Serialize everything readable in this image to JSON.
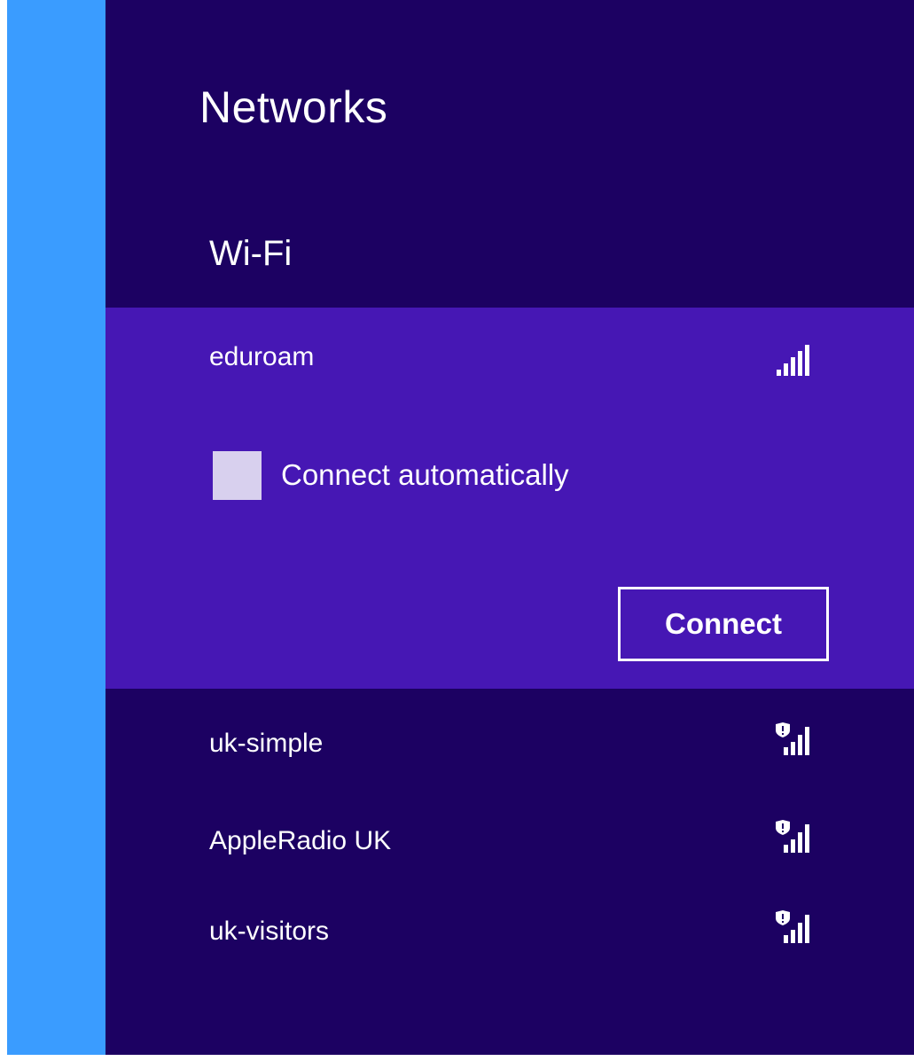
{
  "panel": {
    "title": "Networks",
    "section_label": "Wi-Fi"
  },
  "selected_network": {
    "name": "eduroam",
    "signal_icon": "wifi-signal-icon",
    "connect_auto_label": "Connect automatically",
    "connect_auto_checked": false,
    "connect_button_label": "Connect"
  },
  "networks": [
    {
      "name": "uk-simple",
      "signal_icon": "wifi-signal-unsecured-icon"
    },
    {
      "name": "AppleRadio UK",
      "signal_icon": "wifi-signal-unsecured-icon"
    },
    {
      "name": "uk-visitors",
      "signal_icon": "wifi-signal-unsecured-icon"
    }
  ],
  "colors": {
    "accent_strip": "#3a9cff",
    "panel_bg": "#1c0162",
    "selected_bg": "#4617b4",
    "checkbox_fill": "#d8d0ee"
  }
}
